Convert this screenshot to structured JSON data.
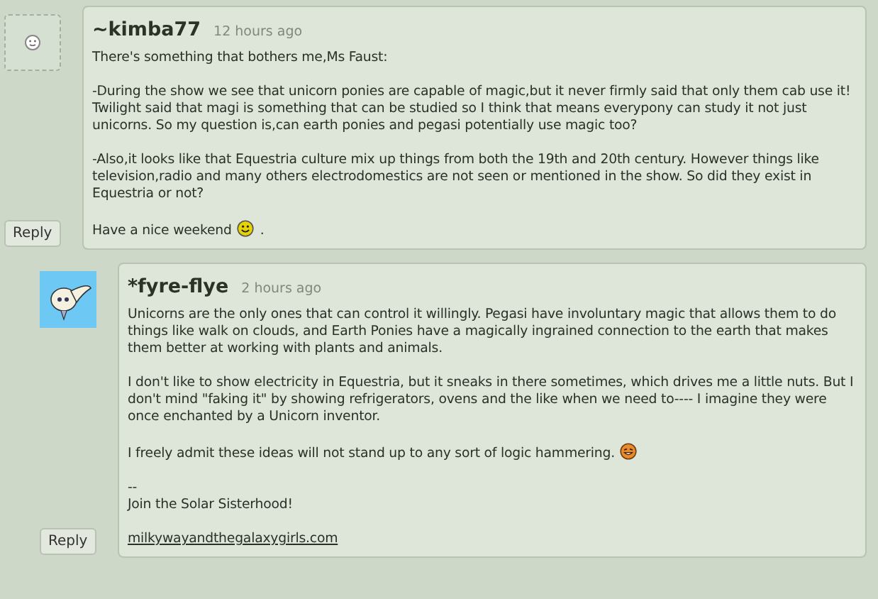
{
  "comments": [
    {
      "username": "~kimba77",
      "time": "12 hours ago",
      "avatar": {
        "kind": "placeholder"
      },
      "indented": false,
      "reply": "Reply",
      "paragraphs": [
        {
          "kind": "text",
          "text": "There's something that bothers me,Ms Faust:"
        },
        {
          "kind": "text",
          "text": "-During the show we see that unicorn ponies are capable of magic,but it never firmly said that only them cab use it! Twilight said that magi is something that can be studied so I think that means everypony can study it not just unicorns. So my question is,can earth ponies and pegasi potentially use magic too?"
        },
        {
          "kind": "text",
          "text": "-Also,it looks like that Equestria culture mix up things from both the 19th and 20th century. However things like television,radio and many others electrodomestics are not seen or mentioned in the show. So did they exist in Equestria or not?"
        },
        {
          "kind": "text",
          "text": "Have a nice weekend",
          "emoticon": {
            "kind": "smile"
          },
          "text_after": "."
        }
      ]
    },
    {
      "username": "*fyre-flye",
      "time": "2 hours ago",
      "avatar": {
        "kind": "picture"
      },
      "indented": true,
      "reply": "Reply",
      "paragraphs": [
        {
          "kind": "text",
          "text": "Unicorns are the only ones that can control it willingly. Pegasi have involuntary magic that allows them to do things like walk on clouds, and Earth Ponies have a magically ingrained connection to the earth that makes them better at working with plants and animals."
        },
        {
          "kind": "text",
          "text": "I don't like to show electricity in Equestria, but it sneaks in there sometimes, which drives me a little nuts. But I don't mind \"faking it\" by showing refrigerators, ovens and the like when we need to---- I imagine they were once enchanted by a Unicorn inventor."
        },
        {
          "kind": "text",
          "text": "I freely admit these ideas will not stand up to any sort of logic hammering.",
          "emoticon": {
            "kind": "grin"
          }
        },
        {
          "kind": "lines",
          "lines": [
            "--",
            "Join the Solar Sisterhood!"
          ]
        },
        {
          "kind": "link",
          "text": "milkywayandthegalaxygirls.com"
        }
      ]
    }
  ]
}
